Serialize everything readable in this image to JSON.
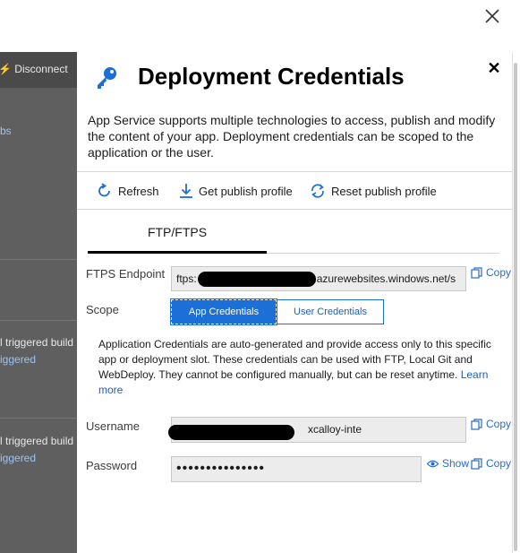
{
  "window": {
    "close_icon": "close-icon"
  },
  "background": {
    "disconnect": "Disconnect",
    "items": [
      {
        "text": "bs"
      },
      {
        "line1": "l triggered build",
        "line2": "iggered"
      },
      {
        "line1": "l triggered build",
        "line2": "iggered"
      }
    ]
  },
  "dialog": {
    "title": "Deployment Credentials",
    "title_icon": "key-icon",
    "intro": "App Service supports multiple technologies to access, publish and modify the content of your app. Deployment credentials can be scoped to the application or the user.",
    "toolbar": {
      "refresh": "Refresh",
      "get_publish_profile": "Get publish profile",
      "reset_publish_profile": "Reset publish profile"
    },
    "tabs": [
      {
        "label": "FTP/FTPS",
        "active": true
      }
    ],
    "ftps_endpoint": {
      "label": "FTPS Endpoint",
      "value_prefix": "ftps:",
      "value_suffix": "p.azurewebsites.windows.net/s",
      "copy_label": "Copy"
    },
    "scope": {
      "label": "Scope",
      "options": [
        "App Credentials",
        "User Credentials"
      ],
      "selected": "App Credentials"
    },
    "scope_description": "Application Credentials are auto-generated and provide access only to this specific app or deployment slot. These credentials can be used with FTP, Local Git and WebDeploy. They cannot be configured manually, but can be reset anytime.",
    "learn_more": "Learn more",
    "username": {
      "label": "Username",
      "value_suffix": "xcalloy-inte",
      "copy_label": "Copy"
    },
    "password": {
      "label": "Password",
      "value": "•••••••••••••••",
      "show_label": "Show",
      "copy_label": "Copy"
    }
  },
  "colors": {
    "accent": "#1c6fd6",
    "overlay": "#5f5f5f",
    "link": "#2a6bc8"
  }
}
